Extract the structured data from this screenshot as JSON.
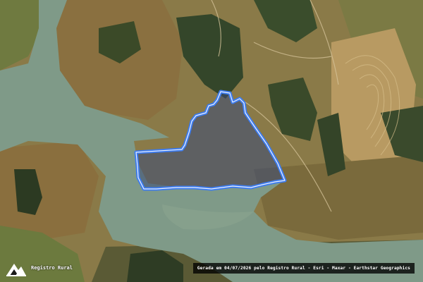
{
  "map": {
    "style": "satellite",
    "colors": {
      "water": "#7f9a88",
      "farmland": "#a08850",
      "forest": "#3c4e2a",
      "boundary_stroke": "#3d7cf0",
      "boundary_fill": "#3a4a78"
    }
  },
  "brand": {
    "name": "Registro Rural",
    "icon": "registro-rural-logo"
  },
  "attribution": "Gerada em 04/07/2026 pelo Registro Rural - Esri - Maxar - Earthstar Geographics"
}
